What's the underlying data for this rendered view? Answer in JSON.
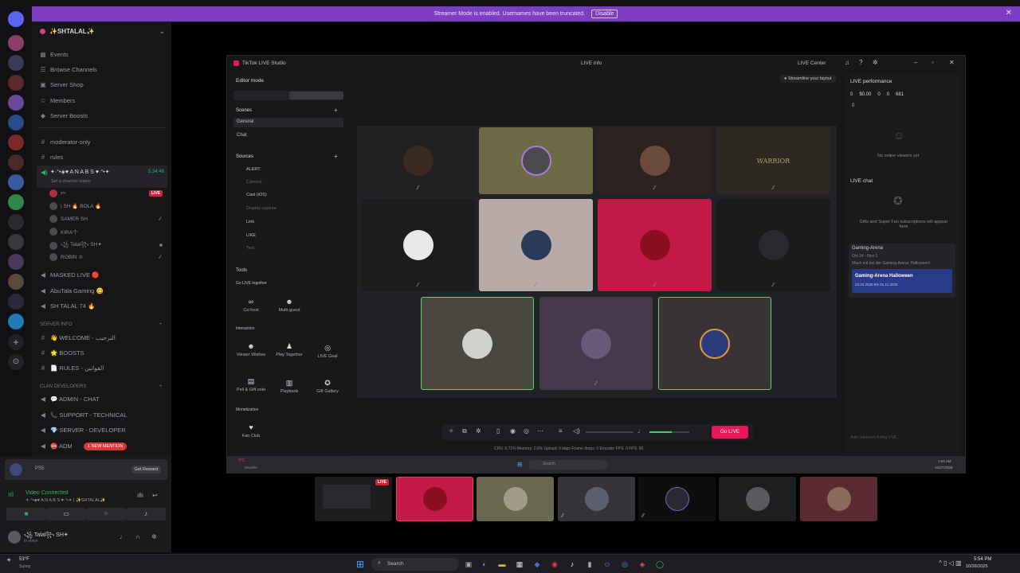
{
  "banner": {
    "text": "Streamer Mode is enabled. Usernames have been truncated.",
    "disable_label": "Disable"
  },
  "server": {
    "name": "✨SHTALAL✨",
    "menu": [
      "Events",
      "Browse Channels",
      "Server Shop",
      "Members",
      "Server Boosts"
    ],
    "channels": [
      {
        "label": "moderator-only",
        "icon": "#"
      },
      {
        "label": "rules",
        "icon": "#"
      }
    ],
    "voice_active": {
      "label": "✦·°•◈♥ A N A  B S ♥·°•✦",
      "time": "5:34:46",
      "status": "Set a channel status"
    },
    "voice_users": [
      {
        "name": "ᵖʳᵒ",
        "badge": "LIVE"
      },
      {
        "name": "| SH 🔥 BOLA 🔥"
      },
      {
        "name": "SAMER SH"
      },
      {
        "name": "KIRA个"
      },
      {
        "name": "꧁ Talal꧂ SH✦"
      },
      {
        "name": "ROBIN ♔"
      }
    ],
    "voice_channels": [
      "MASKED LIVE 🔴",
      "AbuTala Gaming 😋",
      "SH TALAL 74 🔥"
    ],
    "cat_info": "SERVER INFO",
    "info_channels": [
      "👋 WELCOME - الترحيب",
      "🌟 BOOSTS",
      "📄 RULES - القوانين"
    ],
    "cat_clan": "CLAN DEVELOPERS",
    "clan_channels": [
      "💬 ADMIN - CHAT",
      "📞 SUPPORT - TECHNICAL",
      "💎 SERVER - DEVELOPER",
      "⛔ ADM"
    ],
    "mention": "1 NEW MENTION"
  },
  "user_panel": {
    "promo": "Get Reward",
    "ps": "PS5",
    "video_status": "Video Connected",
    "video_channel": "✦·°•◈♥ A N A  B S ♥·°•✦ | ✨SHTALAL✨",
    "username": "꧁ Talal꧂ SH✦",
    "user_status": "In voice",
    "weather_temp": "53°F",
    "weather_desc": "Sunny"
  },
  "tiktok": {
    "app_title": "TikTok LIVE Studio",
    "live_info": "LIVE info",
    "live_center": "LIVE Center",
    "editor_mode": "Editor mode",
    "scenes_label": "Scenes",
    "scenes": [
      "General",
      "Chat"
    ],
    "sources_label": "Sources",
    "sources": [
      "ALERT",
      "Camera",
      "Cast (iOS)",
      "Display capture",
      "Link",
      "LIKE",
      "Text"
    ],
    "tools_label": "Tools",
    "go_live_together": "Go LIVE together",
    "tools_row1": [
      "Co-host",
      "Multi-guest"
    ],
    "interaction": "Interaction",
    "tools_row2": [
      "Viewer Wishes",
      "Play Together",
      "LIVE Goal"
    ],
    "tools_row3": [
      "Poll & Gift vote",
      "Playbook",
      "Gift Gallery"
    ],
    "monetization": "Monetization",
    "fan_club": "Fan Club",
    "streamline": "Streamline your layout",
    "tile_text_warrior": "WARRIOR",
    "go_live_button": "Go LIVE",
    "stats": "CPU: 0.71%   Memory: 0.6%   Upload: 0 kbps   Frame drops: 0   Encoder FPS: 0   FPS: 60",
    "perf_title": "LIVE performance",
    "perf": [
      "0",
      "$0.00",
      "0",
      "0",
      "681",
      "0"
    ],
    "no_viewers": "No online viewers yet",
    "chat_title": "LIVE chat",
    "chat_empty": "Gifts and Super Fan subscriptions will appear here",
    "event_title": "Gaming-Arena",
    "event_dates": "Oct 24 - Nov 1",
    "event_desc": "Mach mit bei der Gaming-Arena: Halloween!",
    "event_banner": "Gaming-Arena Halloween",
    "event_banner_sub": "24.10.2025 Bis 01.11.2025",
    "chat_placeholder": "Add comment during LIVE",
    "inner_search": "Search",
    "inner_time": "1:54 AM",
    "inner_date": "10/27/2025",
    "inner_weather": "9°C",
    "inner_weather_desc": "Bewölkt"
  },
  "thumbnails": {
    "live_badge": "LIVE"
  },
  "taskbar": {
    "search": "Search",
    "time": "5:54 PM",
    "date": "10/26/2025"
  },
  "colors": {
    "banner": "#7c3fc4",
    "go_live": "#e8195a",
    "live_red": "#d81f3a",
    "green_border": "#5fd36a",
    "voice_green": "#2fb360"
  }
}
